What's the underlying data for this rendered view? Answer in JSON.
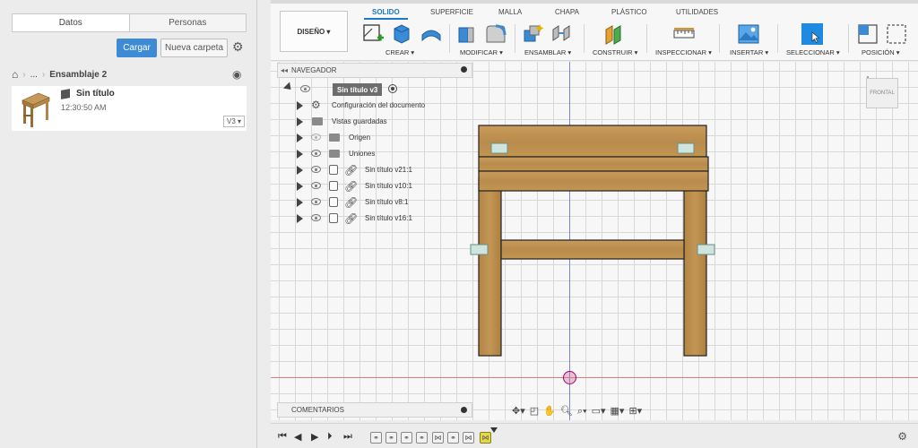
{
  "data_panel": {
    "tabs": [
      {
        "label": "Datos",
        "active": true
      },
      {
        "label": "Personas",
        "active": false
      }
    ],
    "upload_label": "Cargar",
    "new_folder_label": "Nueva carpeta",
    "breadcrumb": {
      "ellipsis": "...",
      "current": "Ensamblaje 2"
    },
    "file": {
      "name": "Sin título",
      "time": "12:30:50 AM",
      "version": "V3 ▾"
    }
  },
  "toolbar": {
    "design_label": "DISEÑO ▾",
    "tabs": [
      {
        "label": "SOLIDO",
        "active": true
      },
      {
        "label": "SUPERFICIE",
        "active": false
      },
      {
        "label": "MALLA",
        "active": false
      },
      {
        "label": "CHAPA",
        "active": false
      },
      {
        "label": "PLÁSTICO",
        "active": false
      },
      {
        "label": "UTILIDADES",
        "active": false
      }
    ],
    "groups": [
      {
        "label": "CREAR ▾",
        "icon": "create-icon"
      },
      {
        "label": "MODIFICAR ▾",
        "icon": "modify-icon"
      },
      {
        "label": "ENSAMBLAR ▾",
        "icon": "assemble-icon"
      },
      {
        "label": "CONSTRUIR ▾",
        "icon": "construct-icon"
      },
      {
        "label": "INSPECCIONAR ▾",
        "icon": "inspect-icon"
      },
      {
        "label": "INSERTAR ▾",
        "icon": "insert-icon"
      },
      {
        "label": "SELECCIONAR ▾",
        "icon": "select-icon"
      },
      {
        "label": "POSICIÓN ▾",
        "icon": "position-icon"
      }
    ]
  },
  "navigator": {
    "title": "NAVEGADOR",
    "root": "Sin título v3",
    "items": [
      {
        "label": "Configuración del documento",
        "kind": "gear"
      },
      {
        "label": "Vistas guardadas",
        "kind": "folder"
      },
      {
        "label": "Origen",
        "kind": "folder-eye"
      },
      {
        "label": "Uniones",
        "kind": "folder-eye"
      },
      {
        "label": "Sin título v21:1",
        "kind": "component"
      },
      {
        "label": "Sin título v10:1",
        "kind": "component"
      },
      {
        "label": "Sin título v8:1",
        "kind": "component"
      },
      {
        "label": "Sin título v16:1",
        "kind": "component"
      }
    ]
  },
  "viewcube_label": "FRONTAL",
  "comments_label": "COMENTARIOS",
  "colors": {
    "accent": "#1e78c2",
    "upload": "#3d8bd4",
    "wood": "#b98b4c",
    "timeline_active": "#e3d74a"
  }
}
